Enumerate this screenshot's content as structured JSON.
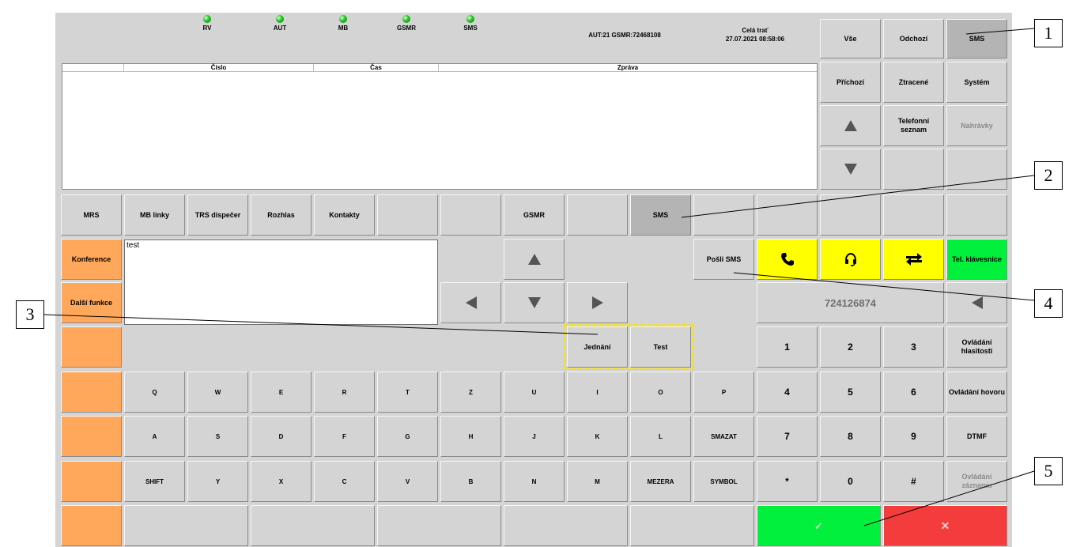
{
  "indicators": [
    "RV",
    "AUT",
    "MB",
    "GSMR",
    "SMS"
  ],
  "status": {
    "aut_gsmr": "AUT:21 GSMR:72468108",
    "route": "Celá trať",
    "datetime": "27.07.2021 08:58:06"
  },
  "table_headers": [
    "Číslo",
    "Čas",
    "Zpráva"
  ],
  "right_tabs": {
    "vse": "Vše",
    "odchozi": "Odchozí",
    "sms": "SMS",
    "prichozi": "Příchozí",
    "ztracene": "Ztracené",
    "system": "Systém",
    "telefonni": "Telefonní\nseznam",
    "nahravky": "Nahrávky"
  },
  "mode_row": [
    "MRS",
    "MB linky",
    "TRS dispečer",
    "Rozhlas",
    "Kontakty",
    "",
    "",
    "GSMR",
    "",
    "SMS",
    "",
    "",
    "",
    "",
    ""
  ],
  "left_col": {
    "konference": "Konference",
    "dalsi": "Další funkce"
  },
  "message_text": "test",
  "posli_sms": "Pošli SMS",
  "tel_klavesnice": "Tel. klávesnice",
  "phone_number": "724126874",
  "templates": {
    "jednani": "Jednání",
    "test": "Test"
  },
  "keyboard": {
    "row1": [
      "Q",
      "W",
      "E",
      "R",
      "T",
      "Z",
      "U",
      "I",
      "O",
      "P"
    ],
    "row2": [
      "A",
      "S",
      "D",
      "F",
      "G",
      "H",
      "J",
      "K",
      "L",
      "SMAZAT"
    ],
    "row3": [
      "SHIFT",
      "Y",
      "X",
      "C",
      "V",
      "B",
      "N",
      "M",
      "MEZERA",
      "SYMBOL"
    ]
  },
  "numpad": {
    "row1": [
      "1",
      "2",
      "3"
    ],
    "row2": [
      "4",
      "5",
      "6"
    ],
    "row3": [
      "7",
      "8",
      "9"
    ],
    "row4": [
      "*",
      "0",
      "#"
    ]
  },
  "side_numpad": {
    "hlasitost": "Ovládání\nhlasitosti",
    "hovoru": "Ovládání hovoru",
    "dtmf": "DTMF",
    "zaznamu": "Ovládání\nzáznamu"
  },
  "confirm_symbol": "✓",
  "cancel_symbol": "✕",
  "callouts": [
    "1",
    "2",
    "3",
    "4",
    "5"
  ],
  "colors": {
    "panel": "#d4d4d4",
    "orange": "#ffa85c",
    "yellow": "#ffff00",
    "green": "#00f03c",
    "red": "#f53c3c"
  }
}
